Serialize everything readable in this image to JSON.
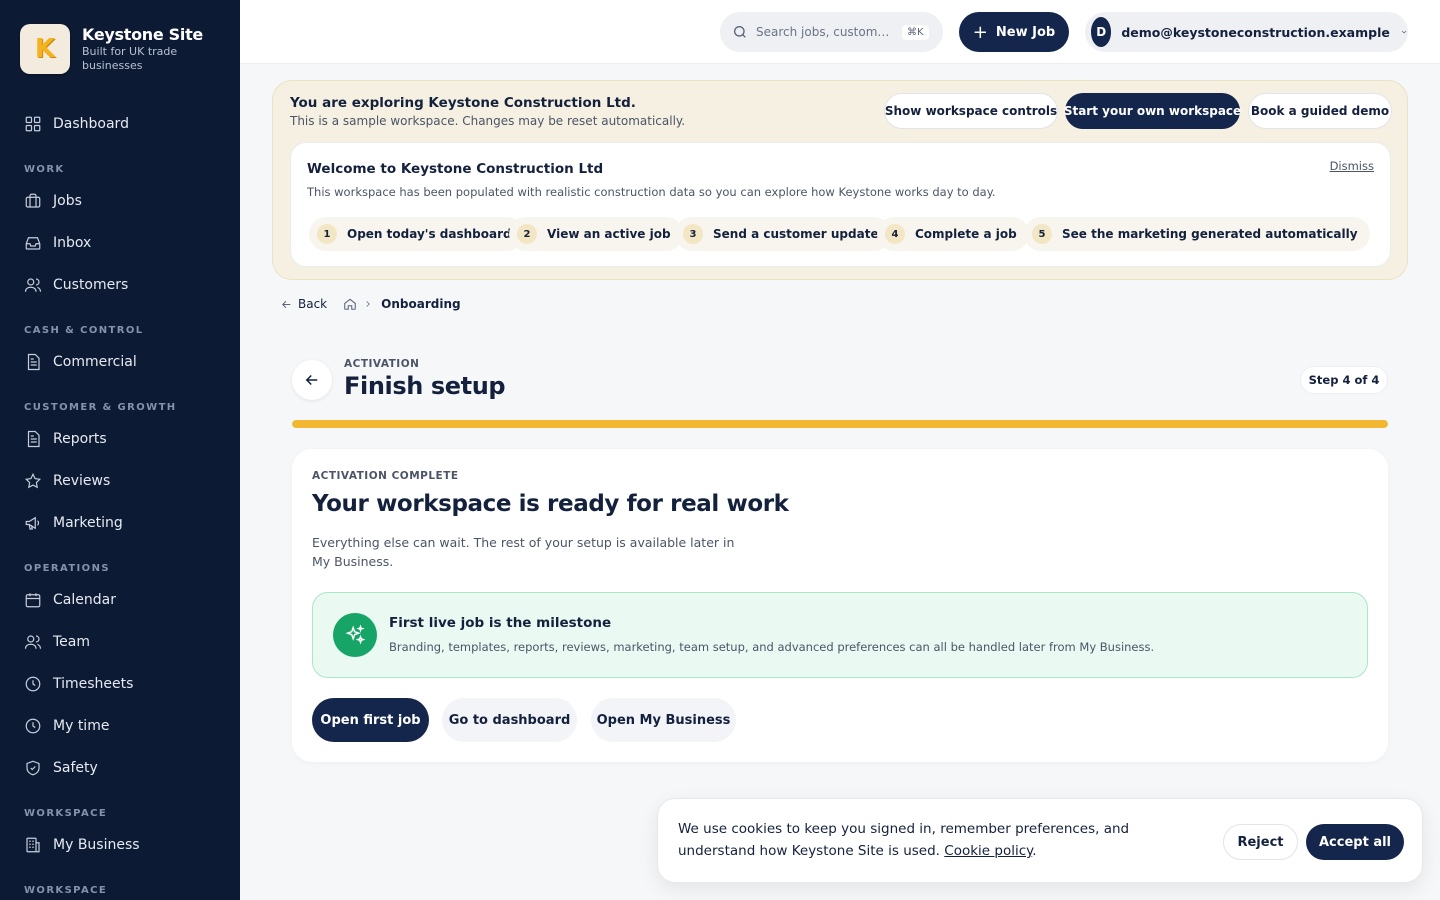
{
  "brand": {
    "logo_letter": "K",
    "name": "Keystone Site",
    "tagline": "Built for UK trade businesses"
  },
  "sidebar": {
    "dashboard": "Dashboard",
    "sections": {
      "work": "WORK",
      "cash": "CASH & CONTROL",
      "growth": "CUSTOMER & GROWTH",
      "operations": "OPERATIONS",
      "workspace1": "WORKSPACE",
      "workspace2": "WORKSPACE"
    },
    "items": {
      "jobs": "Jobs",
      "inbox": "Inbox",
      "customers": "Customers",
      "commercial": "Commercial",
      "reports": "Reports",
      "reviews": "Reviews",
      "marketing": "Marketing",
      "calendar": "Calendar",
      "team": "Team",
      "timesheets": "Timesheets",
      "mytime": "My time",
      "safety": "Safety",
      "mybusiness": "My Business"
    }
  },
  "topbar": {
    "search_placeholder": "Search jobs, customers...",
    "search_shortcut": "⌘K",
    "new_job": "New Job",
    "avatar_initial": "D",
    "user_email": "demo@keystoneconstruction.example"
  },
  "banner": {
    "title": "You are exploring Keystone Construction Ltd.",
    "subtitle": "This is a sample workspace. Changes may be reset automatically.",
    "btn_controls": "Show workspace controls",
    "btn_start": "Start your own workspace",
    "btn_demo": "Book a guided demo",
    "welcome_title": "Welcome to Keystone Construction Ltd",
    "welcome_desc": "This workspace has been populated with realistic construction data so you can explore how Keystone works day to day.",
    "dismiss": "Dismiss",
    "steps": [
      {
        "num": "1",
        "label": "Open today's dashboard"
      },
      {
        "num": "2",
        "label": "View an active job"
      },
      {
        "num": "3",
        "label": "Send a customer update"
      },
      {
        "num": "4",
        "label": "Complete a job"
      },
      {
        "num": "5",
        "label": "See the marketing generated automatically"
      }
    ]
  },
  "breadcrumb": {
    "back": "Back",
    "current": "Onboarding"
  },
  "setup": {
    "eyebrow": "ACTIVATION",
    "title": "Finish setup",
    "step_badge": "Step 4 of 4",
    "progress": 1.0
  },
  "card": {
    "eyebrow": "ACTIVATION COMPLETE",
    "title": "Your workspace is ready for real work",
    "description": "Everything else can wait. The rest of your setup is available later in My Business.",
    "milestone_title": "First live job is the milestone",
    "milestone_desc": "Branding, templates, reports, reviews, marketing, team setup, and advanced preferences can all be handled later from My Business.",
    "btn_first_job": "Open first job",
    "btn_dashboard": "Go to dashboard",
    "btn_my_business": "Open My Business"
  },
  "cookie": {
    "text": "We use cookies to keep you signed in, remember preferences, and understand how Keystone Site is used.",
    "policy_link": "Cookie policy",
    "period": ".",
    "reject": "Reject",
    "accept": "Accept all"
  },
  "colors": {
    "navy": "#14264b",
    "sidebar": "#0d1a33",
    "accent": "#f4b731",
    "success": "#17a467"
  }
}
